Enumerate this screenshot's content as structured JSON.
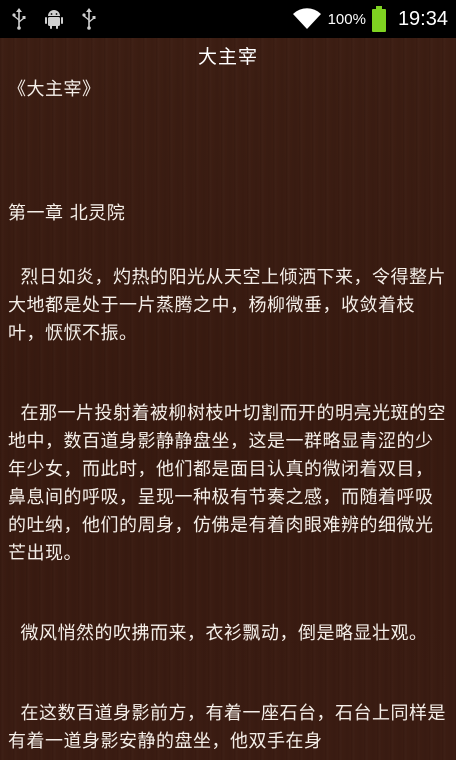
{
  "status_bar": {
    "battery_percent": "100%",
    "time": "19:34",
    "icons": [
      "usb-icon",
      "android-debug-icon",
      "usb-icon",
      "wifi-icon",
      "battery-full-icon"
    ],
    "battery_color": "#7fd321"
  },
  "reader": {
    "title": "大主宰",
    "book_heading": "《大主宰》",
    "chapter_title": "第一章 北灵院",
    "paragraphs": [
      "  烈日如炎，灼热的阳光从天空上倾洒下来，令得整片大地都是处于一片蒸腾之中，杨柳微垂，收敛着枝叶，恹恹不振。",
      "  在那一片投射着被柳树枝叶切割而开的明亮光斑的空地中，数百道身影静静盘坐，这是一群略显青涩的少年少女，而此时，他们都是面目认真的微闭着双目，鼻息间的呼吸，呈现一种极有节奏之感，而随着呼吸的吐纳，他们的周身，仿佛是有着肉眼难辨的细微光芒出现。",
      "  微风悄然的吹拂而来，衣衫飘动，倒是略显壮观。",
      "  在这数百道身影前方，有着一座石台，石台上同样是有着一道身影安静的盘坐，他双手在身"
    ],
    "background_color": "#3a1c12",
    "text_color": "#f5efe9"
  }
}
